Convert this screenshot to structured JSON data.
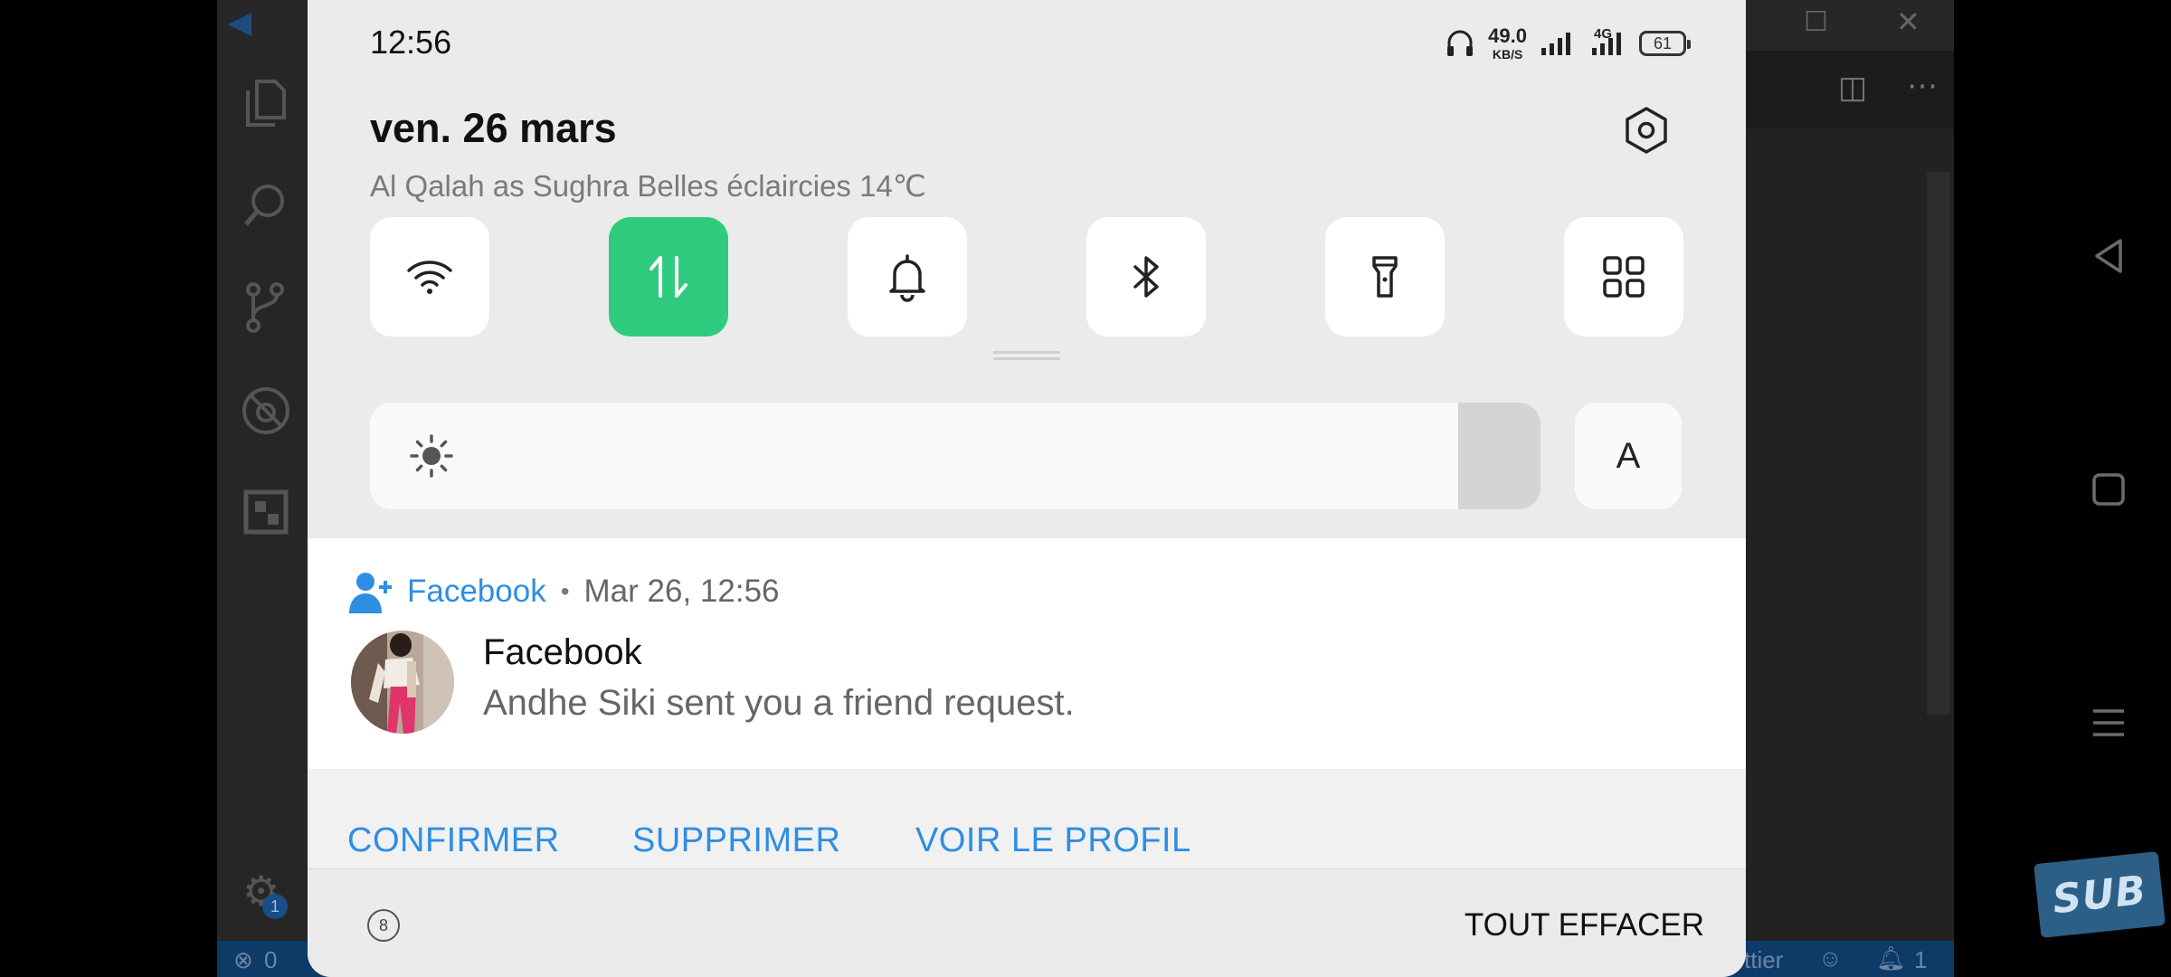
{
  "background_app": {
    "status_left": "0",
    "status_right_text": "ttier",
    "status_bell_count": "1",
    "gear_badge": "1"
  },
  "status_bar": {
    "time": "12:56",
    "net_speed_value": "49.0",
    "net_speed_unit": "KB/S",
    "network_type": "4G",
    "battery": "61"
  },
  "header": {
    "date": "ven. 26 mars",
    "weather": "Al Qalah as Sughra Belles éclaircies 14℃"
  },
  "quick_tiles": [
    {
      "icon": "wifi-icon",
      "active": false
    },
    {
      "icon": "mobile-data-icon",
      "active": true
    },
    {
      "icon": "bell-icon",
      "active": false
    },
    {
      "icon": "bluetooth-icon",
      "active": false
    },
    {
      "icon": "flashlight-icon",
      "active": false
    },
    {
      "icon": "apps-grid-icon",
      "active": false
    }
  ],
  "brightness": {
    "level": 0.93,
    "auto_label": "A"
  },
  "notification": {
    "app_name": "Facebook",
    "separator": "•",
    "time": "Mar 26, 12:56",
    "title": "Facebook",
    "body": "Andhe Siki sent you a friend request.",
    "actions": [
      "CONFIRMER",
      "SUPPRIMER",
      "VOIR LE PROFIL"
    ],
    "accent": "#2f8de4"
  },
  "footer": {
    "clear_all": "TOUT EFFACER",
    "icon_glyph": "8"
  },
  "colors": {
    "tile_active": "#2fcb7e",
    "shade_bg": "#ebebeb",
    "sub_badge": "#2d5f86"
  },
  "watermark": "SUB"
}
